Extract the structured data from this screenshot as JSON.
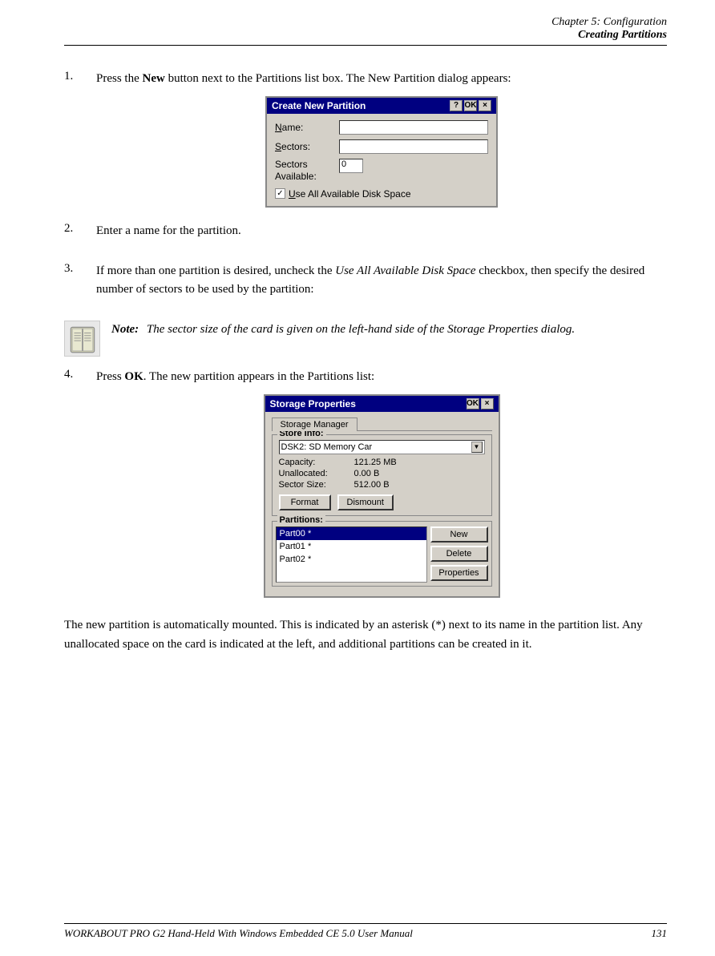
{
  "header": {
    "chapter_line": "Chapter  5:  Configuration",
    "section_line": "Creating Partitions"
  },
  "steps": [
    {
      "number": "1.",
      "text_before_bold": "Press the ",
      "bold_word": "New",
      "text_after": " button next to the Partitions list box. The New Partition dialog appears:"
    },
    {
      "number": "2.",
      "text": "Enter a name for the partition."
    },
    {
      "number": "3.",
      "text_before_italic": "If more than one partition is desired, uncheck the ",
      "italic_word": "Use All Available Disk Space",
      "text_after": " checkbox, then specify the desired number of sectors to be used by the partition:"
    },
    {
      "number": "4.",
      "text_before_bold": "Press ",
      "bold_word": "OK",
      "text_after": ". The new partition appears in the Partitions list:"
    }
  ],
  "note": {
    "label": "Note:",
    "text": "The sector size of the card is given on the left-hand side of the Storage Properties dialog."
  },
  "create_partition_dialog": {
    "title": "Create New Partition",
    "controls": [
      "?",
      "OK",
      "×"
    ],
    "fields": [
      {
        "label": "Name:",
        "underline_char": "N",
        "type": "input"
      },
      {
        "label": "Sectors:",
        "underline_char": "S",
        "type": "input"
      },
      {
        "label": "Sectors\nAvailable:",
        "underline_char": "",
        "type": "value",
        "value": "0"
      }
    ],
    "checkbox_label": "Use All Available Disk Space",
    "checkbox_checked": true
  },
  "storage_dialog": {
    "title": "Storage Properties",
    "ok_btn": "OK",
    "close_btn": "×",
    "tab": "Storage Manager",
    "store_info_label": "Store Info:",
    "store_device": "DSK2: SD Memory Car",
    "capacity_label": "Capacity:",
    "capacity_value": "121.25 MB",
    "unallocated_label": "Unallocated:",
    "unallocated_value": "0.00 B",
    "sector_size_label": "Sector Size:",
    "sector_size_value": "512.00 B",
    "format_btn": "Format",
    "dismount_btn": "Dismount",
    "partitions_label": "Partitions:",
    "partition_items": [
      "Part00 *",
      "Part01 *",
      "Part02 *"
    ],
    "new_btn": "New",
    "delete_btn": "Delete",
    "properties_btn": "Properties"
  },
  "footer_text": "The new partition is automatically mounted. This is indicated by an asterisk (*) next to its name in the partition list. Any unallocated space on the card is indicated at the left, and additional partitions can be created in it.",
  "page_footer": {
    "left": "WORKABOUT PRO G2 Hand-Held With Windows Embedded CE 5.0 User Manual",
    "right": "131"
  }
}
